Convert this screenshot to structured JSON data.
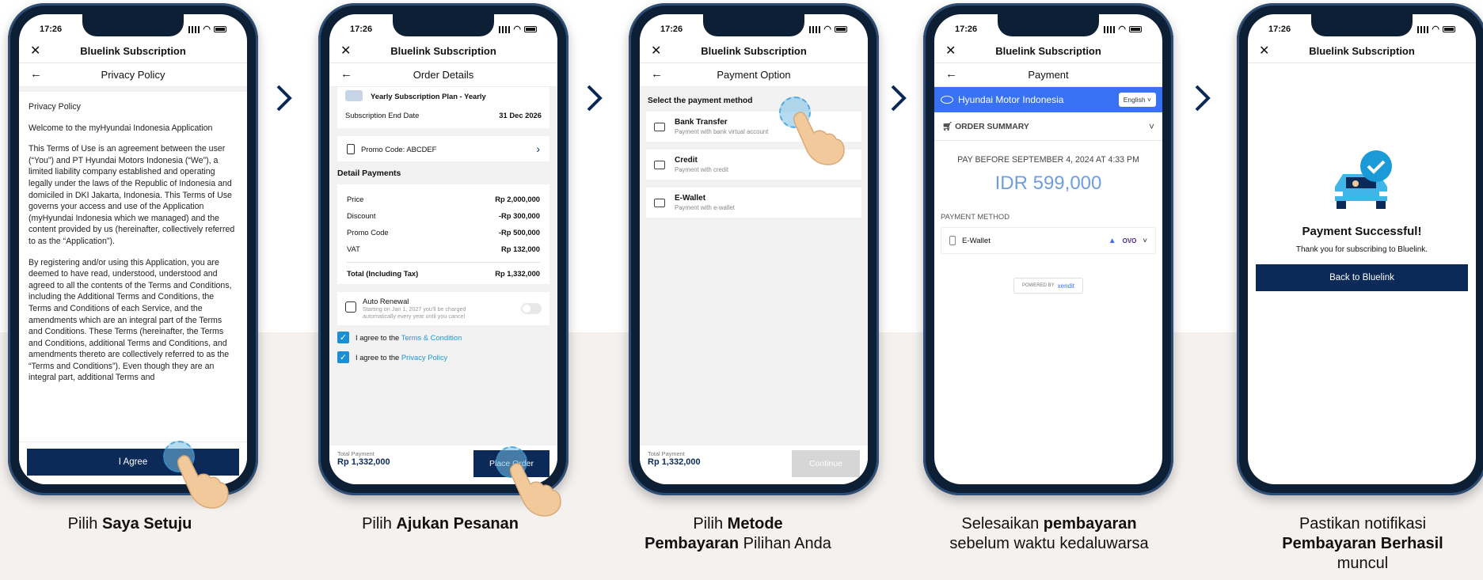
{
  "status_time": "17:26",
  "app_title": "Bluelink Subscription",
  "colors": {
    "navy": "#0b2a57",
    "accent_blue": "#1a9ad6",
    "hyundai_blue": "#3872f2",
    "price_blue": "#6e9de0"
  },
  "screen1": {
    "subtitle": "Privacy Policy",
    "doc_title": "Privacy Policy",
    "p1": "Welcome to the myHyundai Indonesia Application",
    "p2": "This Terms of Use is an agreement between the user (“You”) and PT Hyundai Motors Indonesia (“We”), a limited liability company established and operating legally under the laws of the Republic of Indonesia and domiciled in DKI Jakarta, Indonesia. This Terms of Use governs your access and use of the Application (myHyundai Indonesia which we managed) and the content provided by us (hereinafter, collectively referred to as the “Application”).",
    "p3": "By registering and/or using this Application, you are deemed to have read, understood, understood and agreed to all the contents of the Terms and Conditions, including the Additional Terms and Conditions, the Terms and Conditions of each Service, and the amendments which are an integral part of the Terms and Conditions. These Terms (hereinafter, the Terms and Conditions, additional Terms and Conditions, and amendments thereto are collectively referred to as the “Terms and Conditions”). Even though they are an integral part, additional Terms and",
    "agree_button": "I Agree"
  },
  "screen2": {
    "subtitle": "Order Details",
    "plan": "Yearly Subscription Plan - Yearly",
    "end_date_label": "Subscription End Date",
    "end_date_value": "31 Dec 2026",
    "promo_code": "Promo Code: ABCDEF",
    "detail_title": "Detail Payments",
    "rows": [
      {
        "label": "Price",
        "value": "Rp 2,000,000"
      },
      {
        "label": "Discount",
        "value": "-Rp 300,000"
      },
      {
        "label": "Promo Code",
        "value": "-Rp 500,000"
      },
      {
        "label": "VAT",
        "value": "Rp 132,000"
      }
    ],
    "total_label": "Total (Including Tax)",
    "total_value": "Rp 1,332,000",
    "auto_renewal_title": "Auto Renewal",
    "auto_renewal_desc": "Starting on Jan 1, 2027 you'll be charged automatically every year until you cancel",
    "agree_prefix": "I agree to the",
    "terms_link": "Terms & Condition",
    "privacy_link": "Privacy Policy",
    "total_payment_label": "Total Payment",
    "total_payment_value": "Rp 1,332,000",
    "place_order_button": "Place Order"
  },
  "screen3": {
    "subtitle": "Payment Option",
    "select_label": "Select the payment method",
    "options": [
      {
        "title": "Bank Transfer",
        "desc": "Payment with bank virtual account"
      },
      {
        "title": "Credit",
        "desc": "Payment with credit"
      },
      {
        "title": "E-Wallet",
        "desc": "Payment with e-wallet"
      }
    ],
    "total_payment_label": "Total Payment",
    "total_payment_value": "Rp 1,332,000",
    "continue_button": "Continue"
  },
  "screen4": {
    "subtitle": "Payment",
    "brand": "Hyundai Motor Indonesia",
    "language": "English",
    "order_summary": "ORDER SUMMARY",
    "pay_before": "PAY BEFORE SEPTEMBER 4, 2024 AT 4:33 PM",
    "amount": "IDR 599,000",
    "payment_method_label": "PAYMENT METHOD",
    "method": "E-Wallet",
    "ovo": "OVO",
    "powered_prefix": "POWERED BY",
    "powered_brand": "xendit"
  },
  "screen5": {
    "success_title": "Payment Successful!",
    "success_sub": "Thank you for subscribing to Bluelink.",
    "back_button": "Back to Bluelink"
  },
  "captions": {
    "c1_pre": "Pilih ",
    "c1_bold": "Saya Setuju",
    "c2_pre": "Pilih ",
    "c2_bold": "Ajukan Pesanan",
    "c3_pre": "Pilih ",
    "c3_bold": "Metode Pembayaran",
    "c3_post": " Pilihan Anda",
    "c4_pre": "Selesaikan ",
    "c4_bold": "pembayaran",
    "c4_post": " sebelum waktu kedaluwarsa",
    "c5_pre": "Pastikan notifikasi ",
    "c5_bold": "Pembayaran Berhasil",
    "c5_post": " muncul"
  }
}
